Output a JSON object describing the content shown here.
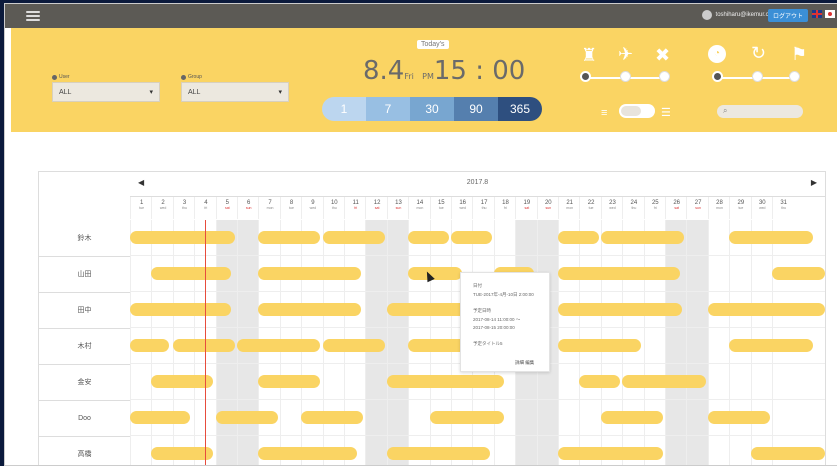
{
  "topbar": {
    "user_email": "toshiharu@ikemur.co",
    "logout_label": "ログアウト",
    "languages": [
      "English",
      "日本語"
    ]
  },
  "filters": {
    "user": {
      "label": "User",
      "value": "ALL"
    },
    "group": {
      "label": "Group",
      "value": "ALL"
    }
  },
  "clock": {
    "today_label": "Today's",
    "date": "8.4",
    "day_suffix": "Fri",
    "period": "PM",
    "time": "15 : 00"
  },
  "range_buttons": [
    "1",
    "7",
    "30",
    "90",
    "365"
  ],
  "range_colors": [
    "#bcd6ef",
    "#98bfe3",
    "#78a6d0",
    "#557fae",
    "#2e4f7f"
  ],
  "activity_icons": [
    "trophy-icon",
    "running-icon",
    "tools-icon"
  ],
  "status_icons": [
    "clock-icon",
    "refresh-icon",
    "flag-icon"
  ],
  "search": {
    "placeholder": ""
  },
  "calendar": {
    "month": "2017.8",
    "days": [
      {
        "n": "1",
        "w": "tue"
      },
      {
        "n": "2",
        "w": "wed"
      },
      {
        "n": "3",
        "w": "thu"
      },
      {
        "n": "4",
        "w": "fri"
      },
      {
        "n": "5",
        "w": "sat",
        "off": true
      },
      {
        "n": "6",
        "w": "sun",
        "off": true
      },
      {
        "n": "7",
        "w": "mon"
      },
      {
        "n": "8",
        "w": "tue"
      },
      {
        "n": "9",
        "w": "wed"
      },
      {
        "n": "10",
        "w": "thu"
      },
      {
        "n": "11",
        "w": "fri",
        "red": true
      },
      {
        "n": "12",
        "w": "sat",
        "off": true
      },
      {
        "n": "13",
        "w": "sun",
        "off": true
      },
      {
        "n": "14",
        "w": "mon"
      },
      {
        "n": "15",
        "w": "tue"
      },
      {
        "n": "16",
        "w": "wed"
      },
      {
        "n": "17",
        "w": "thu"
      },
      {
        "n": "18",
        "w": "fri"
      },
      {
        "n": "19",
        "w": "sat",
        "off": true
      },
      {
        "n": "20",
        "w": "sun",
        "off": true
      },
      {
        "n": "21",
        "w": "mon"
      },
      {
        "n": "22",
        "w": "tue"
      },
      {
        "n": "23",
        "w": "wed"
      },
      {
        "n": "24",
        "w": "thu"
      },
      {
        "n": "25",
        "w": "fri"
      },
      {
        "n": "26",
        "w": "sat",
        "off": true
      },
      {
        "n": "27",
        "w": "sun",
        "off": true
      },
      {
        "n": "28",
        "w": "mon"
      },
      {
        "n": "29",
        "w": "tue"
      },
      {
        "n": "30",
        "w": "wed"
      },
      {
        "n": "31",
        "w": "thu"
      }
    ],
    "members": [
      "鈴木",
      "山田",
      "田中",
      "木村",
      "金安",
      "Doo",
      "高橋"
    ],
    "today_day": 4,
    "schedules": [
      [
        [
          1,
          4.9
        ],
        [
          7,
          8.9
        ],
        [
          10,
          11.9
        ],
        [
          14,
          14.9
        ],
        [
          16,
          16.9
        ],
        [
          21,
          21.9
        ],
        [
          23,
          25.9
        ],
        [
          29,
          31.9
        ]
      ],
      [
        [
          2,
          4.7
        ],
        [
          7,
          10.8
        ],
        [
          14,
          15.5
        ],
        [
          18,
          18.9
        ],
        [
          21,
          25.7
        ],
        [
          31,
          32.9
        ]
      ],
      [
        [
          1,
          4.7
        ],
        [
          7,
          10.8
        ],
        [
          13,
          17.6
        ],
        [
          21,
          25.8
        ],
        [
          28,
          32.9
        ]
      ],
      [
        [
          1,
          1.8
        ],
        [
          3,
          4.9
        ],
        [
          6,
          8.9
        ],
        [
          10,
          11.9
        ],
        [
          14,
          15.7
        ],
        [
          17,
          18.4
        ],
        [
          21,
          23.9
        ],
        [
          29,
          31.9
        ]
      ],
      [
        [
          2,
          3.9
        ],
        [
          7,
          8.9
        ],
        [
          13,
          17.5
        ],
        [
          22,
          22.9
        ],
        [
          24,
          26.9
        ]
      ],
      [
        [
          1,
          2.8
        ],
        [
          5,
          6.9
        ],
        [
          9,
          10.9
        ],
        [
          15,
          17.5
        ],
        [
          23,
          24.9
        ],
        [
          28,
          29.9
        ]
      ],
      [
        [
          2,
          3.9
        ],
        [
          7,
          10.6
        ],
        [
          13,
          16.8
        ],
        [
          21,
          24.9
        ],
        [
          30,
          32.9
        ]
      ]
    ],
    "popup": {
      "row1": "日付",
      "row2": "TUE-2017年-4月-10日 2:00:00",
      "row3": "予定日時",
      "row4": "2017-08-14 11:00:00 〜",
      "row5": "2017-08-15 20:00:00",
      "row6": "予定タイトル5",
      "actions": "詳細 編集"
    }
  }
}
